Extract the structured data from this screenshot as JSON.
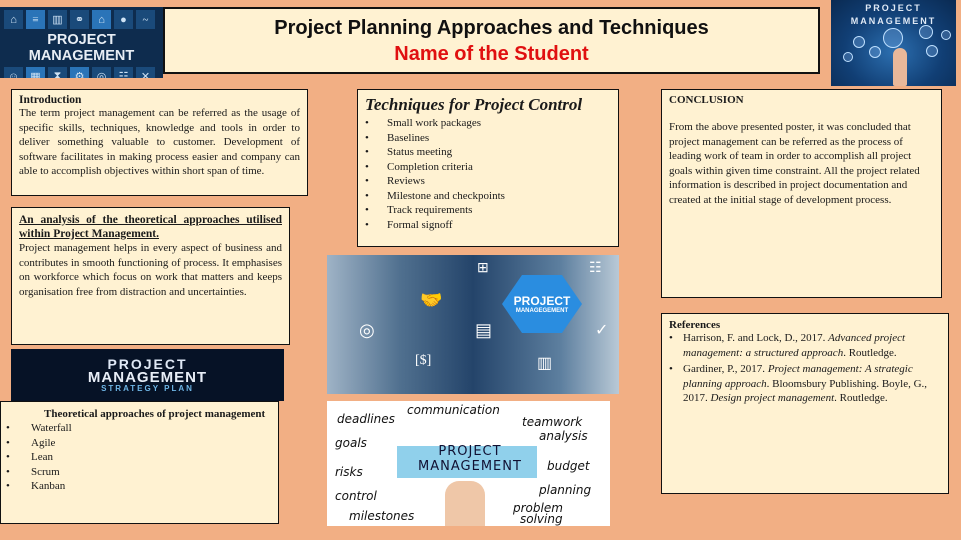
{
  "header": {
    "title": "Project Planning Approaches and Techniques",
    "subtitle": "Name of the Student"
  },
  "images": {
    "top_left": {
      "label": "PROJECT MANAGEMENT"
    },
    "top_right": {
      "label_line1": "PROJECT",
      "label_line2": "MANAGEMENT"
    },
    "word_cloud": {
      "line1": "PROJECT",
      "line2": "MANAGEMENT",
      "line3": "STRATEGY PLAN"
    },
    "hex_image": {
      "line1": "PROJECT",
      "line2": "MANAGEGEMENT"
    },
    "doodle": {
      "center_line1": "PROJECT",
      "center_line2": "MANAGEMENT",
      "words": [
        "communication",
        "deadlines",
        "teamwork",
        "analysis",
        "goals",
        "budget",
        "risks",
        "planning",
        "control",
        "problem",
        "solving",
        "milestones"
      ]
    }
  },
  "introduction": {
    "heading": "Introduction",
    "body": "The term project management can be referred as the usage of specific skills, techniques, knowledge and tools in order to deliver something valuable to customer. Development of software facilitates in making process easier and company can able to accomplish objectives within short span of time."
  },
  "analysis": {
    "heading": "An analysis of the theoretical approaches utilised within Project Management.",
    "body": "Project management helps in every aspect of business and contributes in smooth functioning of process. It emphasises on workforce which focus on work that matters and keeps organisation free from distraction and uncertainties."
  },
  "approaches": {
    "heading": "Theoretical approaches of project management",
    "items": [
      "Waterfall",
      "Agile",
      "Lean",
      "Scrum",
      "Kanban"
    ]
  },
  "techniques": {
    "heading": "Techniques for Project Control",
    "items": [
      "Small work packages",
      "Baselines",
      "Status meeting",
      "Completion criteria",
      "Reviews",
      "Milestone and checkpoints",
      "Track requirements",
      "Formal signoff"
    ]
  },
  "conclusion": {
    "heading": "CONCLUSION",
    "body": "From the above presented poster, it was concluded that project management can be referred as the process of leading work of team in order to accomplish all project goals within given time constraint. All the project related information is described in project documentation and created at the initial stage of development process."
  },
  "references": {
    "heading": "References",
    "items": [
      {
        "pre": "Harrison, F. and Lock, D., 2017. ",
        "title": "Advanced project management: a structured approach",
        "post": ". Routledge."
      },
      {
        "pre": "Gardiner, P., 2017. ",
        "title": "Project management: A strategic planning approach",
        "post": ". Bloomsbury Publishing. Boyle, G., 2017. ",
        "title2": "Design project management",
        "post2": ". Routledge."
      }
    ]
  },
  "bullet": "•"
}
